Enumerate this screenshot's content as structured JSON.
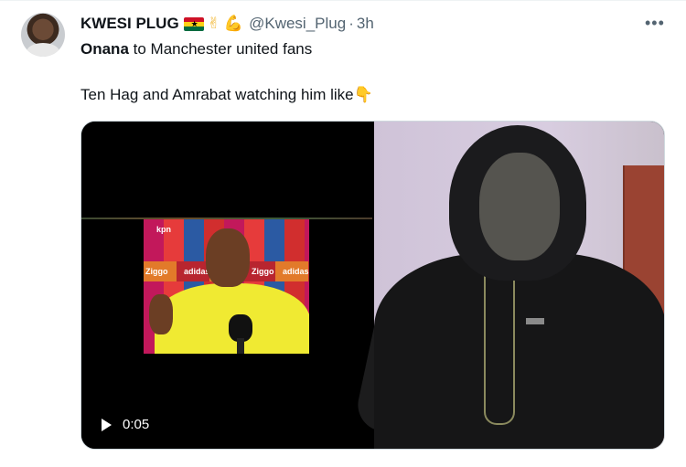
{
  "tweet": {
    "author": {
      "display_name": "KWESI PLUG",
      "handle": "@Kwesi_Plug",
      "time": "3h",
      "separator": "·",
      "badges": [
        "ghana-flag",
        "victory-hand-emoji",
        "flexed-biceps-emoji"
      ]
    },
    "text": {
      "line1_bold": "Onana",
      "line1_rest": " to Manchester united fans",
      "line2": "Ten Hag and Amrabat watching him like",
      "line2_emoji": "👇"
    },
    "more_label": "•••",
    "media": {
      "video": {
        "duration": "0:05",
        "play_icon": "play-icon"
      },
      "inset_labels": [
        "kpn",
        "Ziggo",
        "adidas",
        "Ziggo",
        "adidas"
      ]
    }
  },
  "colors": {
    "text_primary": "#0f1419",
    "text_secondary": "#536471",
    "border": "#cfd9de"
  }
}
